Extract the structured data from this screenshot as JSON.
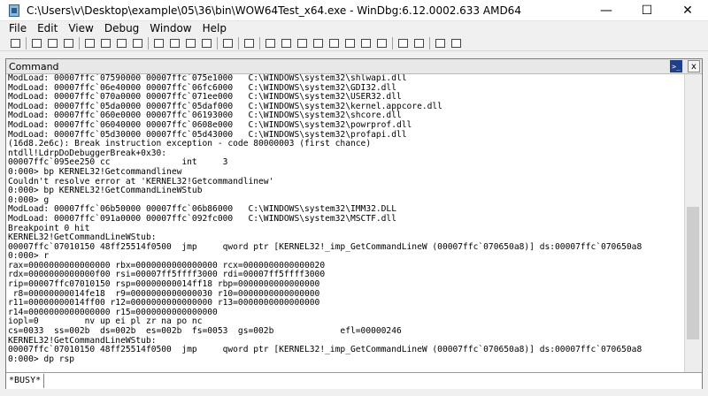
{
  "window": {
    "title": "C:\\Users\\v\\Desktop\\example\\05\\36\\bin\\WOW64Test_x64.exe - WinDbg:6.12.0002.633 AMD64",
    "min_glyph": "—",
    "max_glyph": "☐",
    "close_glyph": "✕"
  },
  "menu": [
    "File",
    "Edit",
    "View",
    "Debug",
    "Window",
    "Help"
  ],
  "toolbar_icons": [
    "open-icon",
    "cut-icon",
    "copy-icon",
    "paste-icon",
    "go-icon",
    "restart-icon",
    "stop-icon",
    "break-icon",
    "step-into-icon",
    "step-over-icon",
    "step-out-icon",
    "run-to-cursor-icon",
    "toggle-breakpoint-icon",
    "hand-icon",
    "watch-icon",
    "locals-icon",
    "registers-icon",
    "memory-icon",
    "callstack-icon",
    "disassembly-icon",
    "scratchpad-icon",
    "command-icon",
    "source-mode-icon",
    "hex-mode-icon",
    "font-icon",
    "options-icon"
  ],
  "command_window": {
    "title": "Command",
    "prompt_glyph": ">_",
    "close_glyph": "x",
    "busy_label": "*BUSY*",
    "input_value": "",
    "lines": [
      "ModLoad: 00007ffc`07590000 00007ffc`075e1000   C:\\WINDOWS\\system32\\shlwapi.dll",
      "ModLoad: 00007ffc`06e40000 00007ffc`06fc6000   C:\\WINDOWS\\system32\\GDI32.dll",
      "ModLoad: 00007ffc`070a0000 00007ffc`071ee000   C:\\WINDOWS\\system32\\USER32.dll",
      "ModLoad: 00007ffc`05da0000 00007ffc`05daf000   C:\\WINDOWS\\system32\\kernel.appcore.dll",
      "ModLoad: 00007ffc`060e0000 00007ffc`06193000   C:\\WINDOWS\\system32\\shcore.dll",
      "ModLoad: 00007ffc`06040000 00007ffc`0608e000   C:\\WINDOWS\\system32\\powrprof.dll",
      "ModLoad: 00007ffc`05d30000 00007ffc`05d43000   C:\\WINDOWS\\system32\\profapi.dll",
      "(16d8.2e6c): Break instruction exception - code 80000003 (first chance)",
      "ntdll!LdrpDoDebuggerBreak+0x30:",
      "00007ffc`095ee250 cc              int     3",
      "0:000> bp KERNEL32!Getcommandlinew",
      "Couldn't resolve error at 'KERNEL32!Getcommandlinew'",
      "0:000> bp KERNEL32!GetCommandLineWStub",
      "0:000> g",
      "ModLoad: 00007ffc`06b50000 00007ffc`06b86000   C:\\WINDOWS\\system32\\IMM32.DLL",
      "ModLoad: 00007ffc`091a0000 00007ffc`092fc000   C:\\WINDOWS\\system32\\MSCTF.dll",
      "Breakpoint 0 hit",
      "KERNEL32!GetCommandLineWStub:",
      "00007ffc`07010150 48ff25514f0500  jmp     qword ptr [KERNEL32!_imp_GetCommandLineW (00007ffc`070650a8)] ds:00007ffc`070650a8",
      "0:000> r",
      "rax=0000000000000000 rbx=0000000000000000 rcx=0000000000000020",
      "rdx=0000000000000f00 rsi=00007ff5ffff3000 rdi=00007ff5ffff3000",
      "rip=00007ffc07010150 rsp=00000000014ff18 rbp=0000000000000000",
      " r8=00000000014fe18  r9=0000000000000030 r10=0000000000000000",
      "r11=00000000014ff00 r12=0000000000000000 r13=0000000000000000",
      "r14=0000000000000000 r15=0000000000000000",
      "iopl=0         nv up ei pl zr na po nc",
      "cs=0033  ss=002b  ds=002b  es=002b  fs=0053  gs=002b             efl=00000246",
      "KERNEL32!GetCommandLineWStub:",
      "00007ffc`07010150 48ff25514f0500  jmp     qword ptr [KERNEL32!_imp_GetCommandLineW (00007ffc`070650a8)] ds:00007ffc`070650a8",
      "0:000> dp rsp"
    ]
  }
}
